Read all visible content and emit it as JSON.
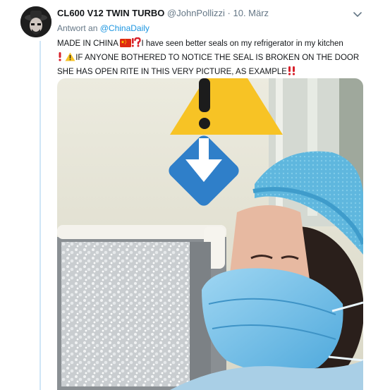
{
  "tweet": {
    "display_name": "CL600 V12 TWIN TURBO",
    "handle": "@JohnPollizzi",
    "separator": "·",
    "date": "10. März",
    "reply_prefix": "Antwort an",
    "reply_to": "@ChinaDaily",
    "line1_a": "MADE IN CHINA",
    "line1_b": "I have seen better seals on my refrigerator in my kitchen",
    "line2": "IF ANYONE BOTHERED TO NOTICE THE SEAL IS BROKEN ON THE DOOR",
    "line3": "SHE HAS OPEN RITE IN THIS VERY PICTURE, AS EXAMPLE"
  },
  "icons": {
    "caret": "chevron-down-icon",
    "flag": "china-flag-icon",
    "exclamation_question": "exclamation-question-icon",
    "exclamation": "red-exclamation-icon",
    "warning": "warning-icon",
    "double_exclamation": "double-exclamation-icon",
    "down_arrow": "down-arrow-icon"
  },
  "colors": {
    "link": "#1b95e0",
    "muted": "#657786",
    "thread_line": "#cfe6f7",
    "warning_yellow": "#f7c325",
    "arrow_blue": "#2f7fc9",
    "alert_red": "#d8202a"
  }
}
